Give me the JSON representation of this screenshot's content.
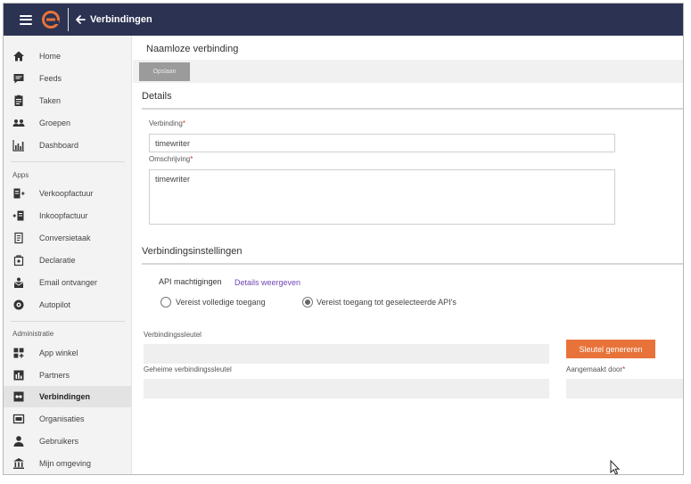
{
  "topbar": {
    "title": "Verbindingen",
    "brand_color": "#e8733a",
    "bar_color": "#2b3252"
  },
  "sidebar": {
    "main_items": [
      {
        "label": "Home",
        "icon": "home-icon"
      },
      {
        "label": "Feeds",
        "icon": "feed-icon"
      },
      {
        "label": "Taken",
        "icon": "tasks-icon"
      },
      {
        "label": "Groepen",
        "icon": "groups-icon"
      },
      {
        "label": "Dashboard",
        "icon": "dashboard-icon"
      }
    ],
    "apps_header": "Apps",
    "apps_items": [
      {
        "label": "Verkoopfactuur",
        "icon": "sales-invoice-icon"
      },
      {
        "label": "Inkoopfactuur",
        "icon": "purchase-invoice-icon"
      },
      {
        "label": "Conversietaak",
        "icon": "conversion-icon"
      },
      {
        "label": "Declaratie",
        "icon": "expense-icon"
      },
      {
        "label": "Email ontvanger",
        "icon": "email-receiver-icon"
      },
      {
        "label": "Autopilot",
        "icon": "autopilot-icon"
      }
    ],
    "admin_header": "Administratie",
    "admin_items": [
      {
        "label": "App winkel",
        "icon": "app-store-icon"
      },
      {
        "label": "Partners",
        "icon": "partners-icon"
      },
      {
        "label": "Verbindingen",
        "icon": "connections-icon",
        "active": true
      },
      {
        "label": "Organisaties",
        "icon": "organisations-icon"
      },
      {
        "label": "Gebruikers",
        "icon": "users-icon"
      },
      {
        "label": "Mijn omgeving",
        "icon": "environment-icon"
      }
    ]
  },
  "main": {
    "page_title": "Naamloze verbinding",
    "save_label": "Opslaan",
    "details_title": "Details",
    "verbinding_label": "Verbinding",
    "verbinding_value": "timewriter",
    "omschrijving_label": "Omschrijving",
    "omschrijving_value": "timewriter",
    "settings_title": "Verbindingsinstellingen",
    "api_label": "API machtigingen",
    "details_link": "Details weergeven",
    "radio_full": "Vereist volledige toegang",
    "radio_selected": "Vereist toegang tot geselecteerde API's",
    "selected_radio": "radio_selected",
    "key_label": "Verbindingssleutel",
    "generate_label": "Sleutel genereren",
    "secret_label": "Geheime verbindingssleutel",
    "created_by_label": "Aangemaakt door",
    "required_mark": "*"
  }
}
